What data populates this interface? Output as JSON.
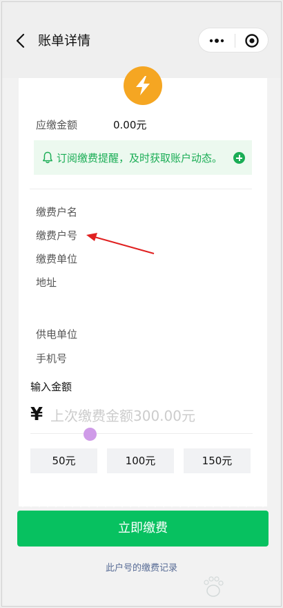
{
  "header": {
    "title": "账单详情"
  },
  "bill": {
    "amount_label": "应缴金额",
    "amount_value": "0.00元"
  },
  "notice": {
    "text": "订阅缴费提醒，及时获取账户动态。"
  },
  "fields": {
    "payer_name": "缴费户名",
    "payer_number": "缴费户号",
    "pay_unit": "缴费单位",
    "address": "地址",
    "supply_unit": "供电单位",
    "phone": "手机号"
  },
  "input": {
    "title": "输入金额",
    "currency": "¥",
    "placeholder": "上次缴费金额300.00元"
  },
  "quick_amounts": [
    "50元",
    "100元",
    "150元"
  ],
  "actions": {
    "pay_now": "立即缴费",
    "records_link": "此户号的缴费记录"
  },
  "colors": {
    "brand_green": "#07c160",
    "notice_green": "#1aad55",
    "badge_orange": "#f5a622",
    "link_blue": "#576b95",
    "annotation_red": "#e02020"
  },
  "icons": {
    "back": "chevron-left-icon",
    "more": "more-dots-icon",
    "close": "target-close-icon",
    "badge": "lightning-bolt-icon",
    "bell": "bell-icon",
    "plus": "plus-circle-icon"
  }
}
